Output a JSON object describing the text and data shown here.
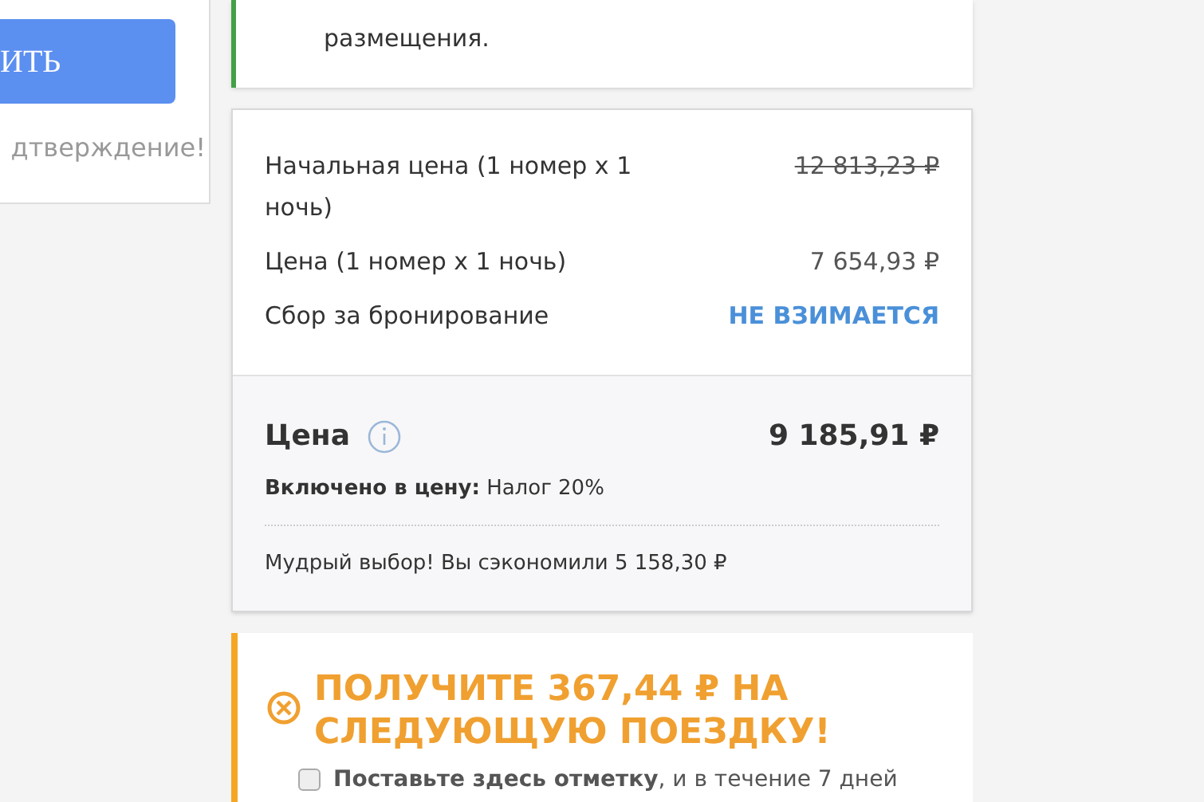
{
  "left_panel": {
    "button": "ИТЬ",
    "note": "дтверждение!"
  },
  "notice": {
    "text": "размещения."
  },
  "price_card": {
    "lines": [
      {
        "label": "Начальная цена (1 номер x 1 ночь)",
        "value": "12 813,23 ₽",
        "kind": "struck"
      },
      {
        "label": "Цена (1 номер x 1 ночь)",
        "value": "7 654,93 ₽",
        "kind": "plain"
      },
      {
        "label": "Сбор за бронирование",
        "value": "НЕ ВЗИМАЕТСЯ",
        "kind": "highlight"
      }
    ],
    "total": {
      "label": "Цена",
      "value": "9 185,91 ₽",
      "included": "**Включено в цену:** Налог 20%",
      "savings": "Мудрый выбор! Вы сэкономили 5 158,30 ₽"
    }
  },
  "reward": {
    "title": "ПОЛУЧИТЕ 367,44 ₽ НА СЛЕДУЮЩУЮ ПОЕЗДКУ!",
    "checkbox": {
      "checked": false,
      "text": "**Поставьте здесь отметку**, и в течение 7 дней"
    }
  }
}
